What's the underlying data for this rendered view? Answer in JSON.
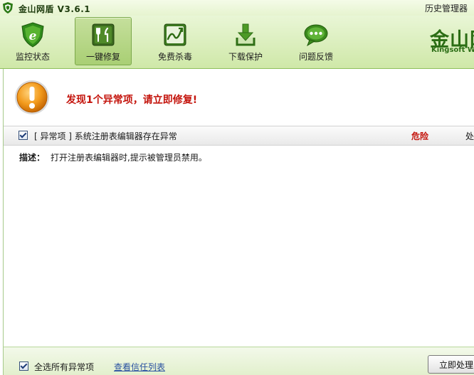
{
  "app": {
    "title": "金山网盾  V3.6.1",
    "history_label": "历史管理器"
  },
  "toolbar": {
    "items": [
      {
        "label": "监控状态",
        "icon": "shield-e-icon"
      },
      {
        "label": "一键修复",
        "icon": "tools-icon",
        "active": true
      },
      {
        "label": "免费杀毒",
        "icon": "trend-icon"
      },
      {
        "label": "下载保护",
        "icon": "download-icon"
      },
      {
        "label": "问题反馈",
        "icon": "chat-bubble-icon"
      }
    ],
    "brand_big": "金山网",
    "brand_small": "Kingsoft W"
  },
  "alert": {
    "message": "发现1个异常项，请立即修复!",
    "icon": "warning-icon",
    "color": "#c4140c"
  },
  "issue": {
    "title": "[ 异常项 ]  系统注册表编辑器存在异常",
    "level": "危险",
    "action_column": "处",
    "description_label": "描述：",
    "description": "打开注册表编辑器时,提示被管理员禁用。"
  },
  "footer": {
    "select_all": "全选所有异常项",
    "trust_link": "查看信任列表",
    "fix_button": "立即处理"
  }
}
